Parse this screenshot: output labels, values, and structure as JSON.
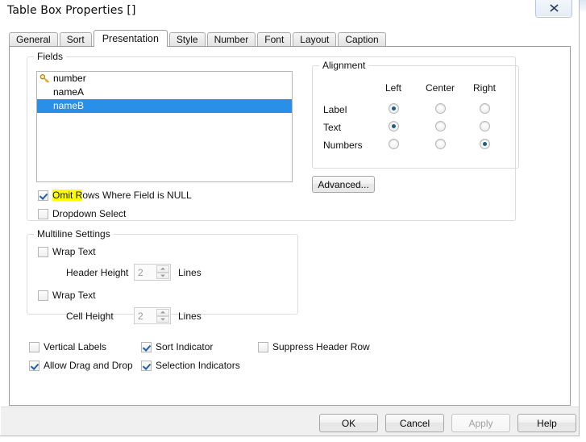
{
  "window": {
    "title": "Table Box Properties []",
    "close_icon": "close-x-icon"
  },
  "tabs": [
    {
      "label": "General",
      "active": false
    },
    {
      "label": "Sort",
      "active": false
    },
    {
      "label": "Presentation",
      "active": true
    },
    {
      "label": "Style",
      "active": false
    },
    {
      "label": "Number",
      "active": false
    },
    {
      "label": "Font",
      "active": false
    },
    {
      "label": "Layout",
      "active": false
    },
    {
      "label": "Caption",
      "active": false
    }
  ],
  "fields": {
    "group_title": "Fields",
    "items": [
      {
        "label": "number",
        "icon": "key-icon",
        "selected": false
      },
      {
        "label": "nameA",
        "icon": "",
        "selected": false
      },
      {
        "label": "nameB",
        "icon": "",
        "selected": true
      }
    ],
    "omit_rows": {
      "label": "Omit Rows Where Field is NULL",
      "checked": true,
      "highlighted": true,
      "highlight_color": "#ffff00"
    },
    "dropdown_select": {
      "label": "Dropdown Select",
      "checked": false
    }
  },
  "alignment": {
    "group_title": "Alignment",
    "columns": [
      "Left",
      "Center",
      "Right"
    ],
    "rows": [
      {
        "label": "Label",
        "selected": "Left"
      },
      {
        "label": "Text",
        "selected": "Left"
      },
      {
        "label": "Numbers",
        "selected": "Right"
      }
    ],
    "advanced_button": "Advanced...",
    "selected_color": "#1a5f80"
  },
  "multiline": {
    "group_title": "Multiline Settings",
    "header": {
      "wrap_label": "Wrap Text",
      "wrap_checked": false,
      "height_label": "Header Height",
      "value": "2",
      "units": "Lines",
      "disabled": true
    },
    "cell": {
      "wrap_label": "Wrap Text",
      "wrap_checked": false,
      "height_label": "Cell Height",
      "value": "2",
      "units": "Lines",
      "disabled": true
    }
  },
  "options": [
    {
      "label": "Vertical Labels",
      "checked": false
    },
    {
      "label": "Sort Indicator",
      "checked": true
    },
    {
      "label": "Suppress Header Row",
      "checked": false
    },
    {
      "label": "Allow Drag and Drop",
      "checked": true
    },
    {
      "label": "Selection Indicators",
      "checked": true
    }
  ],
  "footer": {
    "ok": "OK",
    "cancel": "Cancel",
    "apply": "Apply",
    "apply_disabled": true,
    "help": "Help"
  }
}
